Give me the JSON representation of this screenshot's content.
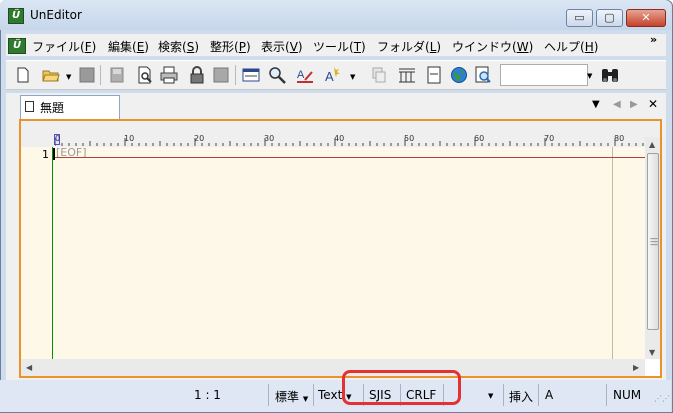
{
  "window": {
    "title": "UnEditor",
    "minimize_glyph": "▭",
    "maximize_glyph": "▢",
    "close_glyph": "✕"
  },
  "menu": {
    "items": [
      {
        "label": "ファイル(",
        "key": "F",
        "suffix": ")"
      },
      {
        "label": "編集(",
        "key": "E",
        "suffix": ")"
      },
      {
        "label": "検索(",
        "key": "S",
        "suffix": ")"
      },
      {
        "label": "整形(",
        "key": "P",
        "suffix": ")"
      },
      {
        "label": "表示(",
        "key": "V",
        "suffix": ")"
      },
      {
        "label": "ツール(",
        "key": "T",
        "suffix": ")"
      },
      {
        "label": "フォルダ(",
        "key": "L",
        "suffix": ")"
      },
      {
        "label": "ウインドウ(",
        "key": "W",
        "suffix": ")"
      },
      {
        "label": "ヘルプ(",
        "key": "H",
        "suffix": ")"
      }
    ],
    "overflow": "»"
  },
  "toolbar": {
    "icons": [
      "new-file-icon",
      "open-folder-icon",
      "save-icon",
      "save-all-icon",
      "print-preview-icon",
      "print-icon",
      "lock-icon",
      "close-doc-icon",
      "window-icon",
      "find-icon",
      "replace-icon",
      "grep-icon",
      "copy-icon",
      "columns-icon",
      "document-icon",
      "globe-icon",
      "web-search-icon",
      "binoculars-icon"
    ],
    "search_value": ""
  },
  "tab": {
    "label": "無題",
    "controls": {
      "menu": "▼",
      "prev": "◀",
      "next": "▶",
      "close": "✕"
    }
  },
  "ruler": {
    "marks": [
      "0",
      "10",
      "20",
      "30",
      "40",
      "50",
      "60",
      "70",
      "80"
    ]
  },
  "editor": {
    "line_number": "1",
    "eof_text": "[EOF]"
  },
  "status": {
    "position": "1 : 1",
    "mode": "標準",
    "file_type": "Text",
    "encoding": "SJIS",
    "line_ending": "CRLF",
    "insert_mode": "挿入",
    "ime": "A",
    "numlock": "NUM"
  },
  "colors": {
    "highlight_box": "#e53131",
    "editor_border": "#e8932c",
    "editor_background": "#fdf8e8"
  }
}
